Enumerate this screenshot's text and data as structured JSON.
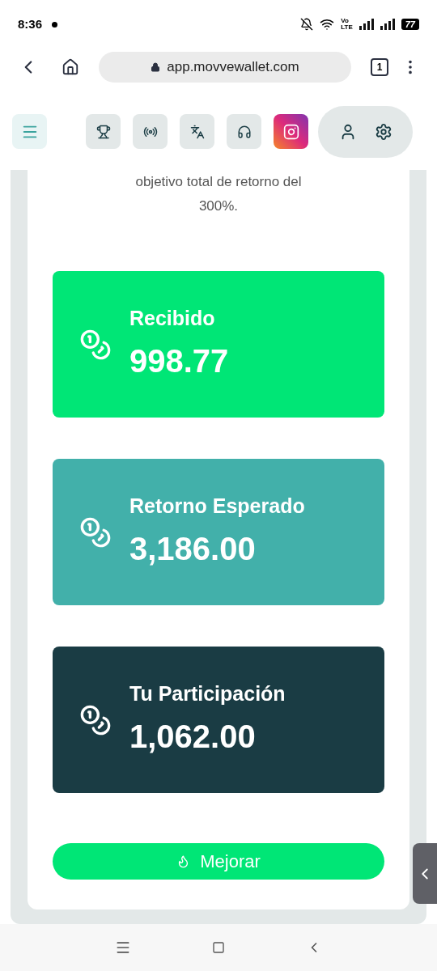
{
  "status_bar": {
    "time": "8:36",
    "network_top": "Vo",
    "network_bottom": "LTE",
    "battery": "77"
  },
  "browser": {
    "url": "app.movvewallet.com",
    "tab_count": "1"
  },
  "intro_text": [
    "objetivo total de retorno del",
    "300%."
  ],
  "cards": [
    {
      "label": "Recibido",
      "value": "998.77",
      "color": "#00e676"
    },
    {
      "label": "Retorno Esperado",
      "value": "3,186.00",
      "color": "#42b0aa"
    },
    {
      "label": "Tu Participación",
      "value": "1,062.00",
      "color": "#1a3c44"
    }
  ],
  "action_button": {
    "label": "Mejorar"
  }
}
